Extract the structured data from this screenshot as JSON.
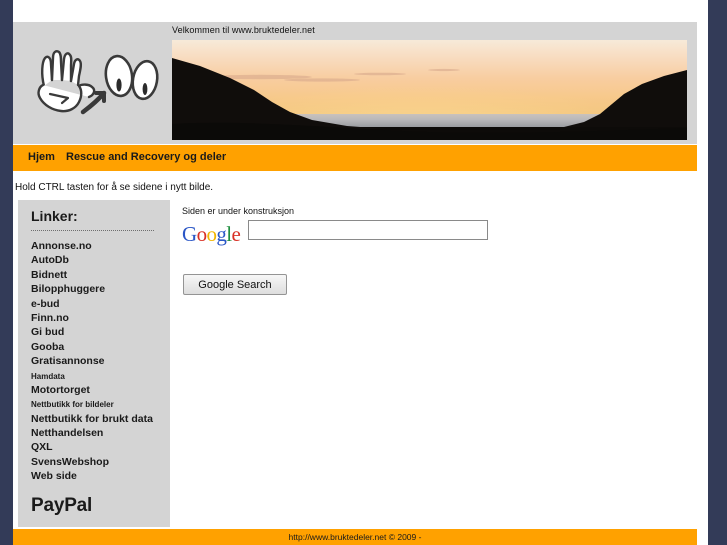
{
  "header": {
    "logo_icon": "waving-hand-and-eyes-logo",
    "banner_caption": "Velkommen til www.bruktedeler.net",
    "banner_photo_alt": "sunset-coastline-photo"
  },
  "nav": {
    "items": [
      {
        "label": "Hjem",
        "name": "nav-item-hjem"
      },
      {
        "label": "Rescue and Recovery og deler",
        "name": "nav-item-rescue"
      }
    ]
  },
  "notice": {
    "text": "Hold CTRL tasten for å se sidene i nytt bilde."
  },
  "sidebar": {
    "title": "Linker:",
    "paypal_label": "PayPal",
    "items": [
      {
        "label": "Annonse.no",
        "size": "normal"
      },
      {
        "label": "AutoDb",
        "size": "normal"
      },
      {
        "label": "Bidnett",
        "size": "normal"
      },
      {
        "label": "Bilopphuggere",
        "size": "normal"
      },
      {
        "label": "e-bud",
        "size": "normal"
      },
      {
        "label": "Finn.no",
        "size": "normal"
      },
      {
        "label": "Gi bud",
        "size": "normal"
      },
      {
        "label": "Gooba",
        "size": "normal"
      },
      {
        "label": "Gratisannonse",
        "size": "normal"
      },
      {
        "label": "Hamdata",
        "size": "small"
      },
      {
        "label": "Motortorget",
        "size": "normal"
      },
      {
        "label": "Nettbutikk for bildeler",
        "size": "small"
      },
      {
        "label": "Nettbutikk for brukt data",
        "size": "normal"
      },
      {
        "label": "Netthandelsen",
        "size": "normal"
      },
      {
        "label": "QXL",
        "size": "normal"
      },
      {
        "label": "SvensWebshop",
        "size": "normal"
      },
      {
        "label": "Web side",
        "size": "normal"
      }
    ]
  },
  "main": {
    "heading": "Siden er under konstruksjon",
    "search": {
      "logo_letters": [
        "G",
        "o",
        "o",
        "g",
        "l",
        "e"
      ],
      "value": "",
      "placeholder": "",
      "button_label": "Google Search"
    }
  },
  "footer": {
    "text": "http://www.bruktedeler.net © 2009 -"
  },
  "colors": {
    "navy_border": "#333b58",
    "orange_bar": "#ffa100",
    "panel_gray": "#d4d4d4",
    "page_white": "#ffffff"
  }
}
